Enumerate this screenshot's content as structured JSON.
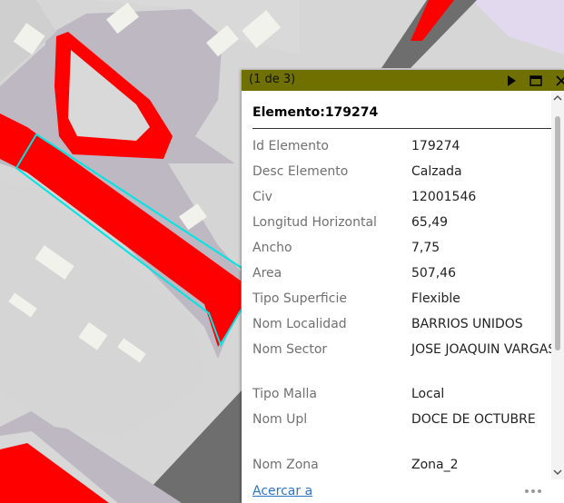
{
  "popup": {
    "counter": "(1 de 3)",
    "title": "Elemento:179274",
    "attributes": [
      {
        "label": "Id Elemento",
        "value": "179274"
      },
      {
        "label": "Desc Elemento",
        "value": "Calzada"
      },
      {
        "label": "Civ",
        "value": "12001546"
      },
      {
        "label": "Longitud Horizontal",
        "value": "65,49"
      },
      {
        "label": "Ancho",
        "value": "7,75"
      },
      {
        "label": "Area",
        "value": "507,46"
      },
      {
        "label": "Tipo Superficie",
        "value": "Flexible"
      },
      {
        "label": "Nom Localidad",
        "value": "BARRIOS UNIDOS"
      },
      {
        "label": "Nom Sector",
        "value": "JOSE JOAQUIN VARGAS"
      },
      {
        "label": "Tipo Malla",
        "value": "Local"
      },
      {
        "label": "Nom Upl",
        "value": "DOCE DE OCTUBRE"
      },
      {
        "label": "Nom Zona",
        "value": "Zona_2"
      }
    ],
    "footer_link": "Acercar a"
  },
  "colors": {
    "header": "#707000",
    "road_fill": "#ff0000",
    "selection_outline": "#00e5e5",
    "block_fill": "#d7d7d7",
    "sidewalk": "#bdb8c2",
    "building": "#f2f2ec",
    "dark_road": "#6e6e6e",
    "lavender": "#e3d9ee"
  }
}
